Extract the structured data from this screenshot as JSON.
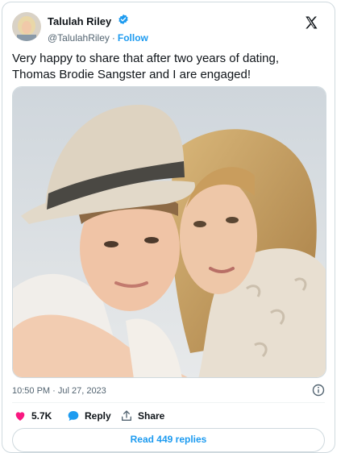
{
  "author": {
    "display_name": "Talulah Riley",
    "handle": "@TalulahRiley",
    "separator": "·",
    "follow_label": "Follow"
  },
  "tweet": {
    "text_line_1": "Very happy to share that after two years of dating,",
    "text_line_2": "Thomas Brodie Sangster and I are engaged!",
    "timestamp": "10:50 PM · Jul 27, 2023"
  },
  "actions": {
    "like_count": "5.7K",
    "reply_label": "Reply",
    "share_label": "Share",
    "read_replies_label": "Read 449 replies"
  },
  "colors": {
    "accent": "#1d9bf0",
    "like": "#f91880",
    "text": "#0f1419",
    "muted": "#536471"
  },
  "icons": [
    "verified-badge-icon",
    "x-logo-icon",
    "info-icon",
    "heart-icon",
    "reply-bubble-icon",
    "share-icon"
  ]
}
